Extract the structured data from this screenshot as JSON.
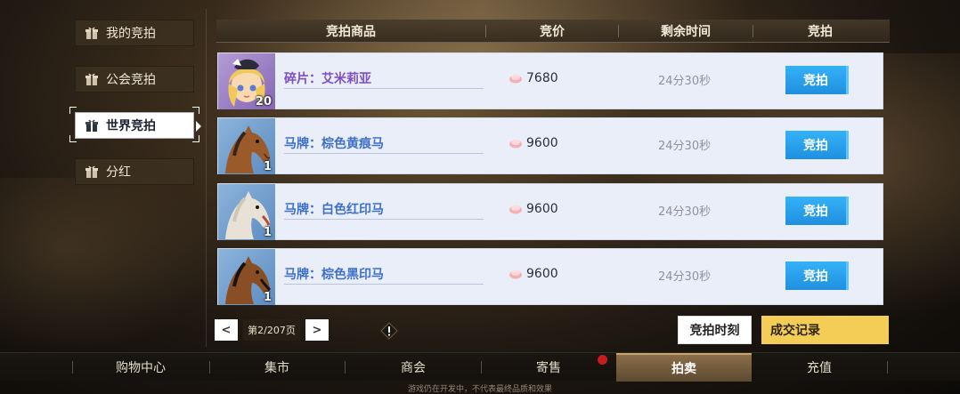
{
  "sidebar": {
    "items": [
      {
        "label": "我的竞拍",
        "icon": "gift-icon",
        "active": false
      },
      {
        "label": "公会竞拍",
        "icon": "gift-icon",
        "active": false
      },
      {
        "label": "世界竞拍",
        "icon": "gift-icon",
        "active": true
      },
      {
        "label": "分红",
        "icon": "gift-icon",
        "active": false
      }
    ]
  },
  "table": {
    "headers": [
      "竞拍商品",
      "竞价",
      "剩余时间",
      "竞拍"
    ],
    "rows": [
      {
        "name": "碎片：艾米莉亚",
        "count": "20",
        "price": "7680",
        "time": "24分30秒",
        "bid_label": "竞拍",
        "thumb": "character-portrait"
      },
      {
        "name": "马牌：棕色黄痕马",
        "count": "1",
        "price": "9600",
        "time": "24分30秒",
        "bid_label": "竞拍",
        "thumb": "brown-horse"
      },
      {
        "name": "马牌：白色红印马",
        "count": "1",
        "price": "9600",
        "time": "24分30秒",
        "bid_label": "竞拍",
        "thumb": "white-horse"
      },
      {
        "name": "马牌：棕色黑印马",
        "count": "1",
        "price": "9600",
        "time": "24分30秒",
        "bid_label": "竞拍",
        "thumb": "dark-brown-horse"
      }
    ]
  },
  "pager": {
    "prev": "<",
    "next": ">",
    "label": "第2/207页"
  },
  "actions": {
    "time_label": "竞拍时刻",
    "record_label": "成交记录"
  },
  "bottom_nav": {
    "items": [
      "购物中心",
      "集市",
      "商会",
      "寄售",
      "拍卖",
      "充值"
    ],
    "active_index": 4
  },
  "footer_note": "游戏仍在开发中，不代表最终品质和效果",
  "colors": {
    "bid_button": "#2aa3f0",
    "record_button": "#f4cd57",
    "row_bg": "#e9eef8"
  }
}
